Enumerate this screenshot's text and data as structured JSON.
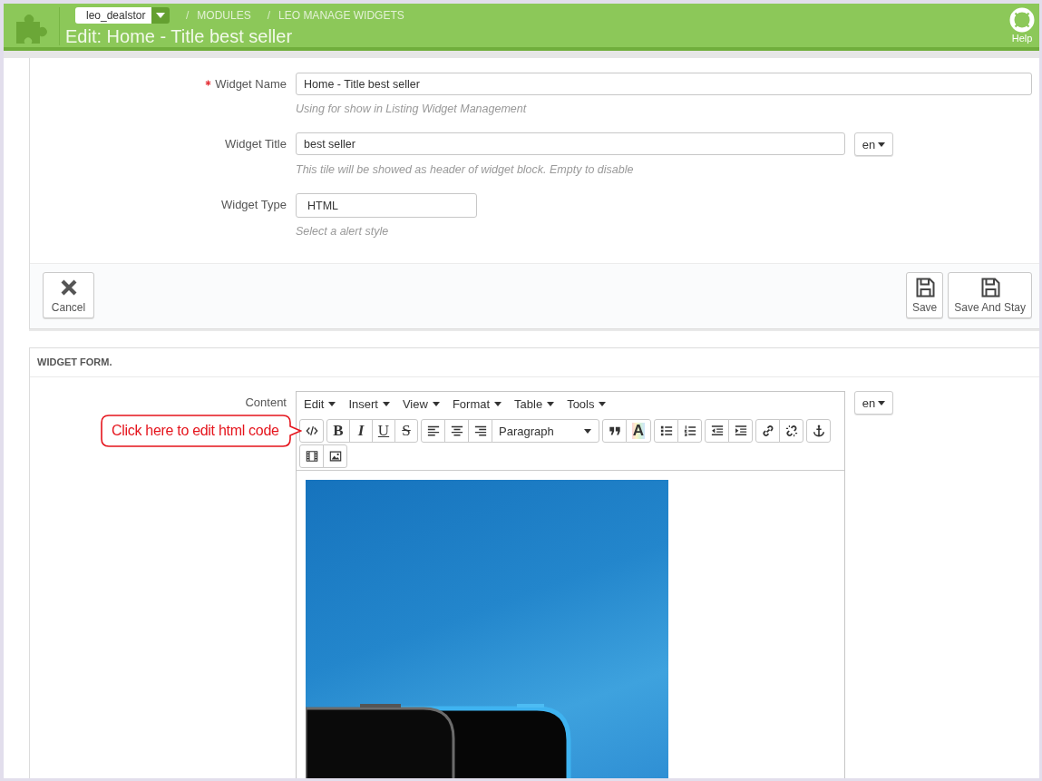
{
  "header": {
    "shop_selector": {
      "value": "leo_dealstor"
    },
    "breadcrumb": [
      {
        "separator": "/",
        "label": "MODULES"
      },
      {
        "separator": "/",
        "label": "LEO MANAGE WIDGETS"
      }
    ],
    "title": "Edit: Home - Title best seller",
    "help": {
      "label": "Help"
    }
  },
  "settings_panel": {
    "fields": [
      {
        "kind": "text",
        "label": "Widget Name",
        "required": true,
        "value": "Home - Title best seller",
        "hint": "Using for show in Listing Widget Management"
      },
      {
        "kind": "text",
        "label": "Widget Title",
        "required": false,
        "value": "best seller",
        "language": "en",
        "hint": "This tile will be showed as header of widget block. Empty to disable"
      },
      {
        "kind": "select",
        "label": "Widget Type",
        "required": false,
        "value": "HTML",
        "hint": "Select a alert style"
      }
    ],
    "buttons": [
      {
        "kind": "cancel",
        "label": "Cancel"
      },
      {
        "kind": "save",
        "label": "Save"
      },
      {
        "kind": "save",
        "label": "Save And Stay"
      }
    ]
  },
  "widget_form": {
    "title": "WIDGET FORM.",
    "content_label": "Content",
    "language": "en",
    "editor": {
      "menus": [
        "Edit",
        "Insert",
        "View",
        "Format",
        "Table",
        "Tools"
      ],
      "toolbar_rows": [
        [
          [
            {
              "kind": "code"
            }
          ],
          [
            {
              "kind": "bold",
              "glyph": "B"
            },
            {
              "kind": "italic",
              "glyph": "I"
            },
            {
              "kind": "underline",
              "glyph": "U"
            },
            {
              "kind": "strikethrough",
              "glyph": "S"
            }
          ],
          [
            {
              "kind": "align-left"
            },
            {
              "kind": "align-center"
            },
            {
              "kind": "align-right"
            },
            {
              "kind": "format-select",
              "value": "Paragraph"
            }
          ],
          [
            {
              "kind": "blockquote"
            },
            {
              "kind": "text-color",
              "glyph": "A"
            }
          ],
          [
            {
              "kind": "bullet-list"
            },
            {
              "kind": "numbered-list"
            }
          ],
          [
            {
              "kind": "outdent"
            },
            {
              "kind": "indent"
            }
          ],
          [
            {
              "kind": "link"
            },
            {
              "kind": "unlink"
            }
          ],
          [
            {
              "kind": "anchor"
            }
          ]
        ],
        [
          [
            {
              "kind": "video"
            },
            {
              "kind": "image"
            }
          ]
        ]
      ],
      "content": [
        {
          "kind": "image"
        }
      ]
    }
  },
  "annotation": {
    "text": "Click here to edit html code"
  }
}
